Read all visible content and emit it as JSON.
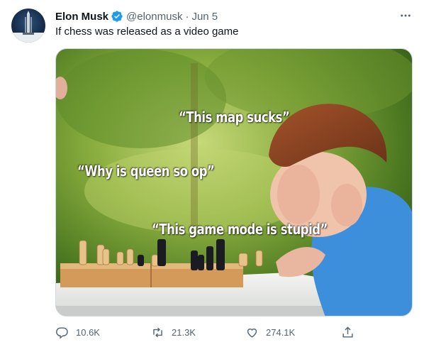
{
  "author": {
    "name": "Elon Musk",
    "handle": "@elonmusk",
    "separator": "·",
    "date": "Jun 5"
  },
  "tweet": {
    "text": "If chess was released as a video game"
  },
  "media": {
    "captions": [
      "“This map sucks”",
      "“Why is queen so op”",
      "“This game mode is stupid”"
    ]
  },
  "actions": {
    "replies": "10.6K",
    "retweets": "21.3K",
    "likes": "274.1K"
  },
  "icons": {
    "verified": "verified-badge-icon",
    "more": "more-options-icon",
    "reply": "reply-icon",
    "retweet": "retweet-icon",
    "like": "heart-icon",
    "share": "share-icon"
  },
  "colors": {
    "verified": "#1d9bf0",
    "text_primary": "#0f1419",
    "text_secondary": "#536471"
  }
}
